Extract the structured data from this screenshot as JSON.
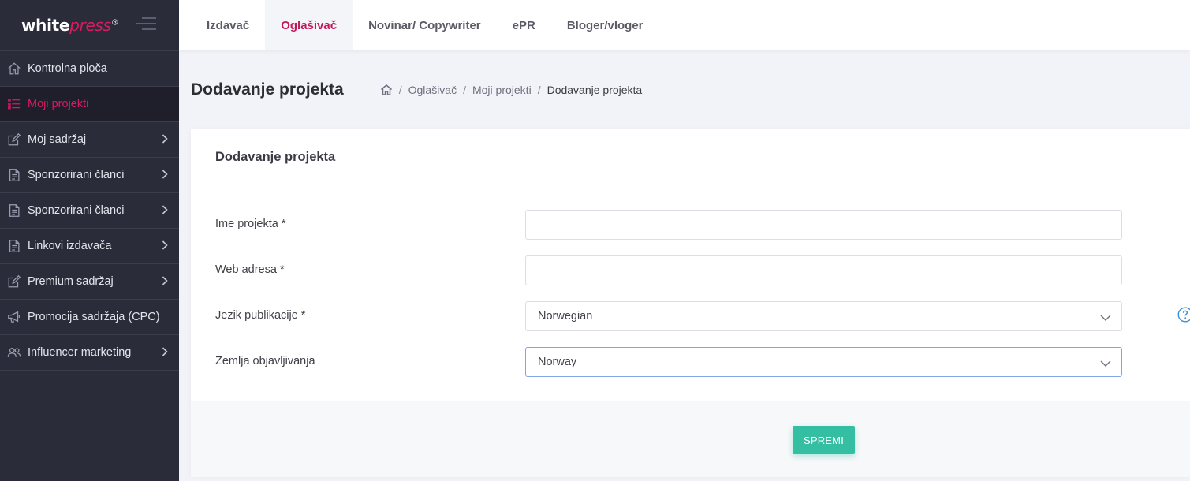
{
  "brand": {
    "logo_white": "white",
    "logo_accent": "press",
    "logo_mark": "®"
  },
  "sidebar": {
    "items": [
      {
        "label": "Kontrolna ploča",
        "icon": "home-icon",
        "active": false,
        "has_chevron": false
      },
      {
        "label": "Moji projekti",
        "icon": "list-icon",
        "active": true,
        "has_chevron": false
      },
      {
        "label": "Moj sadržaj",
        "icon": "edit-icon",
        "active": false,
        "has_chevron": true
      },
      {
        "label": "Sponzorirani članci",
        "icon": "document-icon",
        "active": false,
        "has_chevron": true
      },
      {
        "label": "Sponzorirani članci",
        "icon": "document-icon",
        "active": false,
        "has_chevron": true
      },
      {
        "label": "Linkovi izdavača",
        "icon": "document-icon",
        "active": false,
        "has_chevron": true
      },
      {
        "label": "Premium sadržaj",
        "icon": "edit-icon",
        "active": false,
        "has_chevron": true
      },
      {
        "label": "Promocija sadržaja (CPC)",
        "icon": "megaphone-icon",
        "active": false,
        "has_chevron": false
      },
      {
        "label": "Influencer marketing",
        "icon": "users-icon",
        "active": false,
        "has_chevron": true
      }
    ]
  },
  "topnav": {
    "tabs": [
      {
        "label": "Izdavač",
        "active": false
      },
      {
        "label": "Oglašivač",
        "active": true
      },
      {
        "label": "Novinar/ Copywriter",
        "active": false
      },
      {
        "label": "ePR",
        "active": false
      },
      {
        "label": "Bloger/vloger",
        "active": false
      }
    ]
  },
  "subheader": {
    "title": "Dodavanje projekta",
    "breadcrumb": [
      "Oglašivač",
      "Moji projekti",
      "Dodavanje projekta"
    ],
    "separator": "/"
  },
  "card": {
    "title": "Dodavanje projekta",
    "fields": {
      "project_name": {
        "label": "Ime projekta *",
        "value": ""
      },
      "web_address": {
        "label": "Web adresa *",
        "value": ""
      },
      "language": {
        "label": "Jezik publikacije *",
        "value": "Norwegian"
      },
      "country": {
        "label": "Zemlja objavljivanja",
        "value": "Norway"
      }
    },
    "save_label": "SPREMI"
  },
  "colors": {
    "sidebar_bg": "#2b2c3a",
    "accent": "#d81b60",
    "save_button": "#34bfa3",
    "help_icon": "#3f8fd6"
  }
}
